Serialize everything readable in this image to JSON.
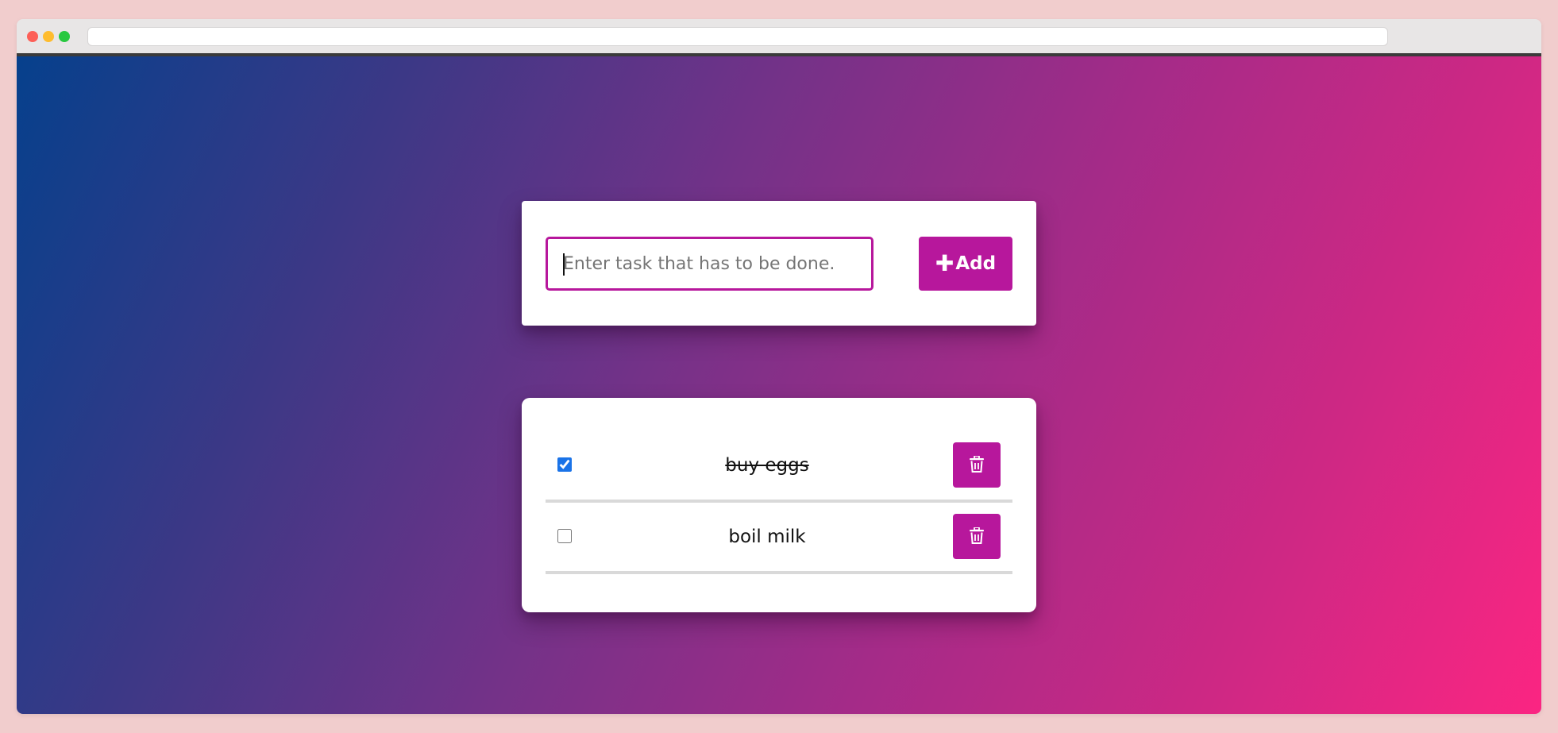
{
  "browser": {
    "url": ""
  },
  "colors": {
    "accent": "#b7179c",
    "gradient_start": "#06408c",
    "gradient_end": "#fb2582",
    "checkbox": "#1a73e8"
  },
  "form": {
    "input_value": "",
    "placeholder": "Enter task that has to be done.",
    "add_icon": "plus-icon",
    "add_label": "Add"
  },
  "tasks": [
    {
      "text": "buy eggs",
      "done": true,
      "delete_icon": "trash-icon"
    },
    {
      "text": "boil milk",
      "done": false,
      "delete_icon": "trash-icon"
    }
  ]
}
